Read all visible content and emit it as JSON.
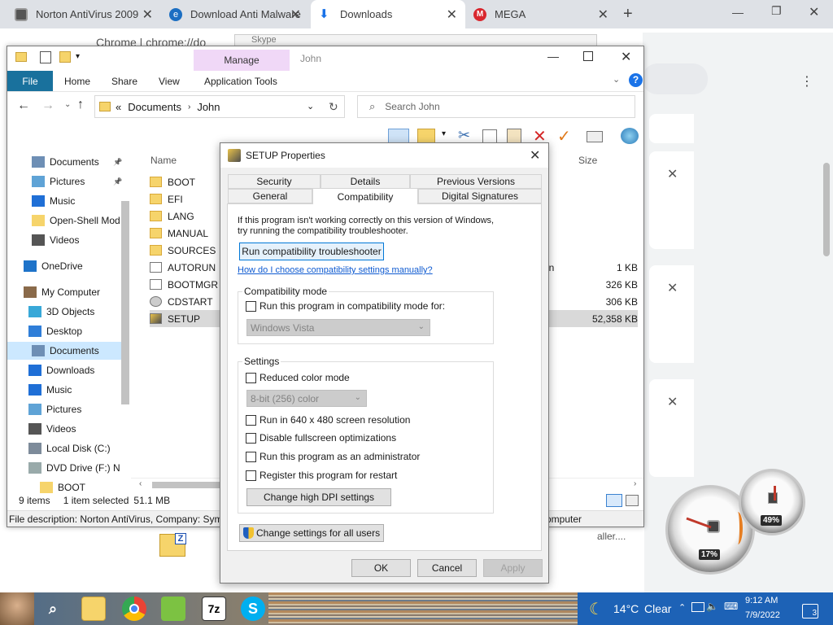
{
  "chrome": {
    "tabs": [
      {
        "title": "Norton AntiVirus 2009",
        "icon": "document-icon",
        "active": false
      },
      {
        "title": "Download Anti Malware",
        "icon": "ie-icon",
        "active": false
      },
      {
        "title": "Downloads",
        "icon": "download-icon",
        "active": true
      },
      {
        "title": "MEGA",
        "icon": "mega-icon",
        "active": false
      }
    ],
    "new_tab": "+",
    "omnibox_text": "Chrome | chrome://do",
    "skype_window_title": "Skype",
    "downloads_items": [
      {
        "text": "aller...."
      }
    ]
  },
  "explorer": {
    "window_title": "John",
    "manage_label": "Manage",
    "ribbon_tabs": [
      "File",
      "Home",
      "Share",
      "View",
      "Application Tools"
    ],
    "address": {
      "prefix": "«",
      "path": [
        "Documents",
        "John"
      ]
    },
    "search_placeholder": "Search John",
    "columns": {
      "name": "Name",
      "size": "Size"
    },
    "nav_items": [
      {
        "label": "Documents",
        "icon": "documents-icon",
        "pinned": true
      },
      {
        "label": "Pictures",
        "icon": "pictures-icon",
        "pinned": true
      },
      {
        "label": "Music",
        "icon": "music-icon"
      },
      {
        "label": "Open-Shell Mod",
        "icon": "folder-icon"
      },
      {
        "label": "Videos",
        "icon": "videos-icon"
      },
      {
        "label": "OneDrive",
        "icon": "onedrive-icon"
      },
      {
        "label": "My Computer",
        "icon": "computer-icon"
      },
      {
        "label": "3D Objects",
        "icon": "3d-objects-icon"
      },
      {
        "label": "Desktop",
        "icon": "desktop-icon"
      },
      {
        "label": "Documents",
        "icon": "documents-icon",
        "selected": true
      },
      {
        "label": "Downloads",
        "icon": "downloads-icon"
      },
      {
        "label": "Music",
        "icon": "music-icon"
      },
      {
        "label": "Pictures",
        "icon": "pictures-icon"
      },
      {
        "label": "Videos",
        "icon": "videos-icon"
      },
      {
        "label": "Local Disk (C:)",
        "icon": "disk-icon"
      },
      {
        "label": "DVD Drive (F:) N",
        "icon": "dvd-icon"
      },
      {
        "label": "BOOT",
        "icon": "folder-icon"
      }
    ],
    "files": [
      {
        "name": "BOOT",
        "type_hint": "",
        "size": "",
        "icon": "folder-icon"
      },
      {
        "name": "EFI",
        "type_hint": "",
        "size": "",
        "icon": "folder-icon"
      },
      {
        "name": "LANG",
        "type_hint": "",
        "size": "",
        "icon": "folder-icon"
      },
      {
        "name": "MANUAL",
        "type_hint": "",
        "size": "",
        "icon": "folder-icon"
      },
      {
        "name": "SOURCES",
        "type_hint": "",
        "size": "",
        "icon": "folder-icon"
      },
      {
        "name": "AUTORUN",
        "type_hint": "on",
        "size": "1 KB",
        "icon": "autorun-icon"
      },
      {
        "name": "BOOTMGR",
        "type_hint": "",
        "size": "326 KB",
        "icon": "file-icon"
      },
      {
        "name": "CDSTART",
        "type_hint": "",
        "size": "306 KB",
        "icon": "cdstart-icon"
      },
      {
        "name": "SETUP",
        "type_hint": "",
        "size": "52,358 KB",
        "icon": "setup-icon",
        "selected": true
      }
    ],
    "status": {
      "items": "9 items",
      "selected": "1 item selected",
      "size": "51.1 MB"
    },
    "description": "File description: Norton AntiVirus, Company: Sym",
    "description_right": "omputer"
  },
  "dialog": {
    "title": "SETUP Properties",
    "tabs_row1": [
      "Security",
      "Details",
      "Previous Versions"
    ],
    "tabs_row2": [
      "General",
      "Compatibility",
      "Digital Signatures"
    ],
    "active_tab": "Compatibility",
    "intro": "If this program isn't working correctly on this version of Windows, try running the compatibility troubleshooter.",
    "troubleshooter_button": "Run compatibility troubleshooter",
    "manual_link": "How do I choose compatibility settings manually?",
    "compat_mode": {
      "group_label": "Compatibility mode",
      "checkbox": "Run this program in compatibility mode for:",
      "checked": false,
      "select_value": "Windows Vista"
    },
    "settings": {
      "group_label": "Settings",
      "reduced_color": "Reduced color mode",
      "color_select": "8-bit (256) color",
      "options": [
        "Run in 640 x 480 screen resolution",
        "Disable fullscreen optimizations",
        "Run this program as an administrator",
        "Register this program for restart"
      ],
      "dpi_button": "Change high DPI settings"
    },
    "all_users_button": "Change settings for all users",
    "ok": "OK",
    "cancel": "Cancel",
    "apply": "Apply"
  },
  "gadget": {
    "cpu": "17%",
    "memory": "49%"
  },
  "taskbar": {
    "weather_temp": "14°C",
    "weather_text": "Clear",
    "time": "9:12 AM",
    "date": "7/9/2022",
    "notifications": "3",
    "pinned": [
      "search-icon",
      "file-explorer-icon",
      "chrome-icon",
      "android-icon",
      "7zip-icon",
      "skype-icon"
    ]
  }
}
